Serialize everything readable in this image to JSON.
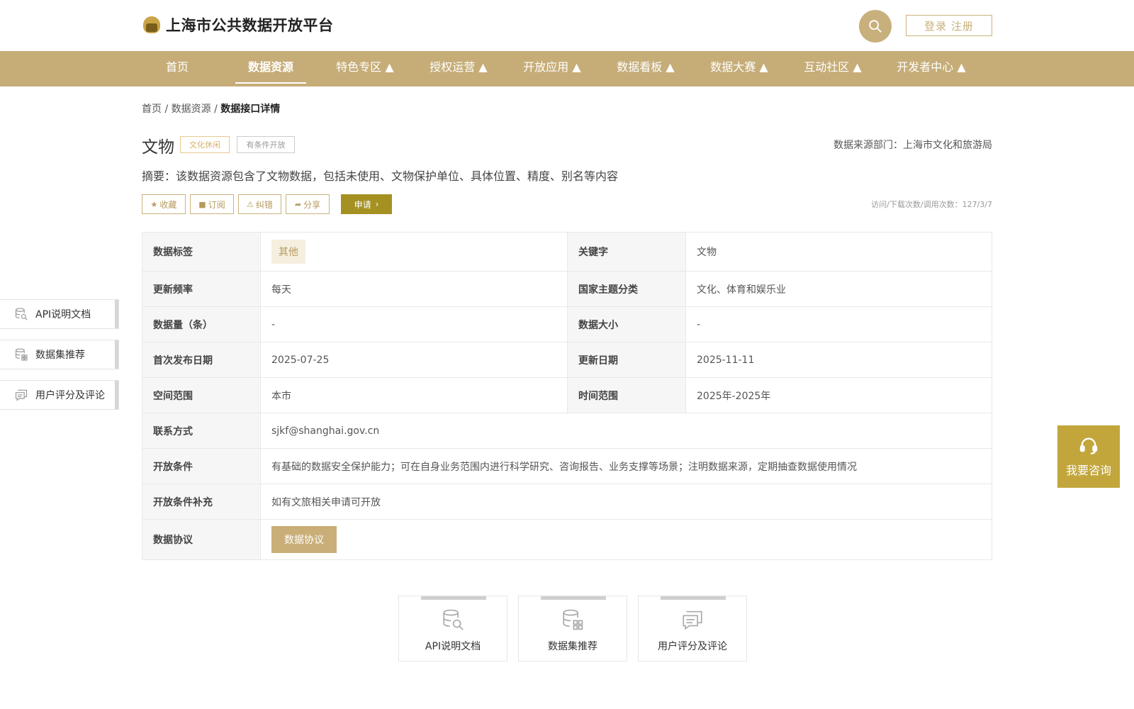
{
  "header": {
    "site_title": "上海市公共数据开放平台",
    "login_text": "登录 注册"
  },
  "nav": {
    "items": [
      {
        "label": "首页"
      },
      {
        "label": "数据资源"
      },
      {
        "label": "特色专区 ▲"
      },
      {
        "label": "授权运营 ▲"
      },
      {
        "label": "开放应用 ▲"
      },
      {
        "label": "数据看板 ▲"
      },
      {
        "label": "数据大赛 ▲"
      },
      {
        "label": "互动社区 ▲"
      },
      {
        "label": "开发者中心 ▲"
      }
    ],
    "active_index": 1
  },
  "breadcrumb": {
    "home": "首页",
    "sep1": " / ",
    "section": "数据资源",
    "sep2": " / ",
    "current": "数据接口详情"
  },
  "detail": {
    "title": "文物",
    "tags": [
      "文化休闲",
      "有条件开放"
    ],
    "source": "数据来源部门：上海市文化和旅游局",
    "abstract": "摘要：该数据资源包含了文物数据，包括未使用、文物保护单位、具体位置、精度、别名等内容",
    "actions": {
      "favorite": "收藏",
      "subscribe": "订阅",
      "report": "纠错",
      "share": "分享",
      "apply": "申请"
    },
    "stats": "访问/下载次数/调用次数：127/3/7"
  },
  "table": {
    "data_tag_label": "数据标签",
    "data_tag_value": "其他",
    "keyword_label": "关键字",
    "keyword_value": "文物",
    "freq_label": "更新频率",
    "freq_value": "每天",
    "national_label": "国家主题分类",
    "national_value": "文化、体育和娱乐业",
    "count_label": "数据量（条）",
    "count_value": "-",
    "size_label": "数据大小",
    "size_value": "-",
    "first_pub_label": "首次发布日期",
    "first_pub_value": "2025-07-25",
    "update_label": "更新日期",
    "update_value": "2025-11-11",
    "space_label": "空间范围",
    "space_value": "本市",
    "time_label": "时间范围",
    "time_value": "2025年-2025年",
    "contact_label": "联系方式",
    "contact_value": "sjkf@shanghai.gov.cn",
    "cond_label": "开放条件",
    "cond_value": "有基础的数据安全保护能力；可在自身业务范围内进行科学研究、咨询报告、业务支撑等场景；注明数据来源，定期抽查数据使用情况",
    "cond_extra_label": "开放条件补充",
    "cond_extra_value": "如有文旅相关申请可开放",
    "protocol_label": "数据协议",
    "protocol_button": "数据协议"
  },
  "side_menu": {
    "api": "API说明文档",
    "dataset": "数据集推荐",
    "comment": "用户评分及评论"
  },
  "consult": {
    "label": "我要咨询"
  },
  "cards": {
    "api": "API说明文档",
    "dataset": "数据集推荐",
    "comment": "用户评分及评论"
  },
  "colors": {
    "brand": "#c6ad78",
    "apply": "#a59122",
    "consult": "#c2a63b"
  }
}
